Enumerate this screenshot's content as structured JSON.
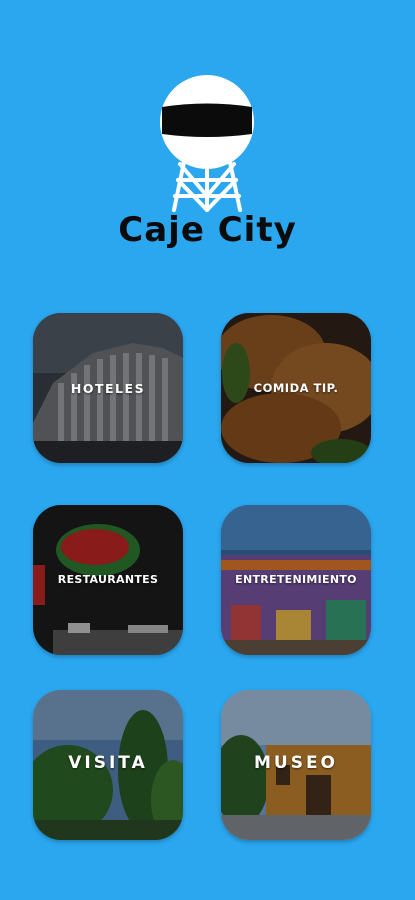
{
  "app": {
    "title": "Caje City",
    "background_color": "#2aa7ef",
    "logo_icon": "water-tower-icon"
  },
  "tiles": [
    {
      "label": "HOTELES",
      "image": "building-photo"
    },
    {
      "label": "COMIDA TIP.",
      "image": "empanadas-photo"
    },
    {
      "label": "RESTAURANTES",
      "image": "chilis-sign-photo"
    },
    {
      "label": "ENTRETENIMIENTO",
      "image": "market-stalls-photo"
    },
    {
      "label": "VISITA",
      "image": "trees-sky-photo"
    },
    {
      "label": "MUSEO",
      "image": "colonial-building-photo"
    }
  ]
}
